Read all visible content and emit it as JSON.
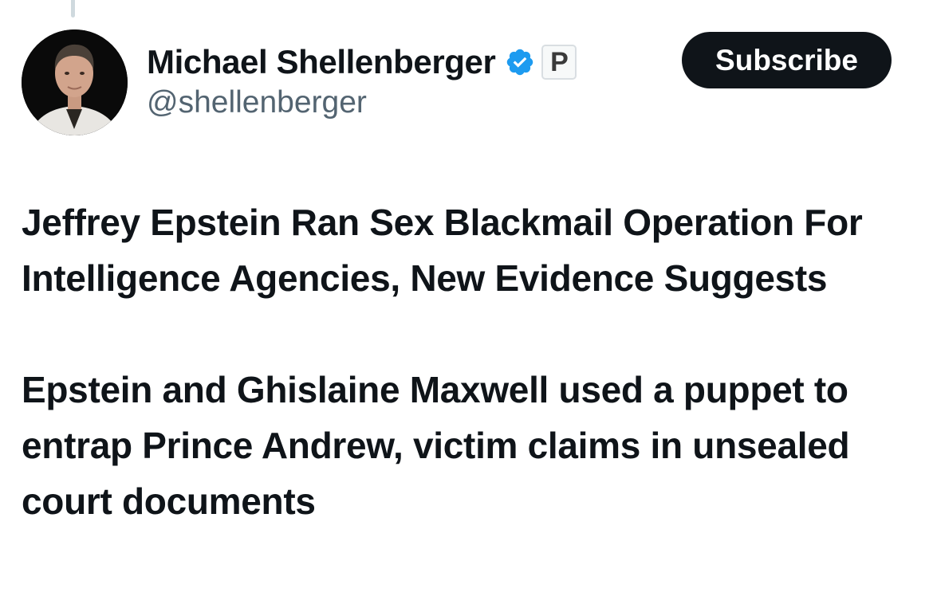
{
  "author": {
    "display_name": "Michael Shellenberger",
    "handle": "@shellenberger",
    "badge_letter": "P",
    "avatar_icon": "profile-photo",
    "verified_icon": "verified-badge-icon",
    "verified_color": "#1d9bf0"
  },
  "actions": {
    "subscribe_label": "Subscribe"
  },
  "tweet": {
    "headline": "Jeffrey Epstein Ran Sex Blackmail Operation For Intelligence Agencies, New Evidence Suggests",
    "subheadline": "Epstein and Ghislaine Maxwell used a puppet to entrap Prince Andrew, victim claims in unsealed court documents"
  }
}
